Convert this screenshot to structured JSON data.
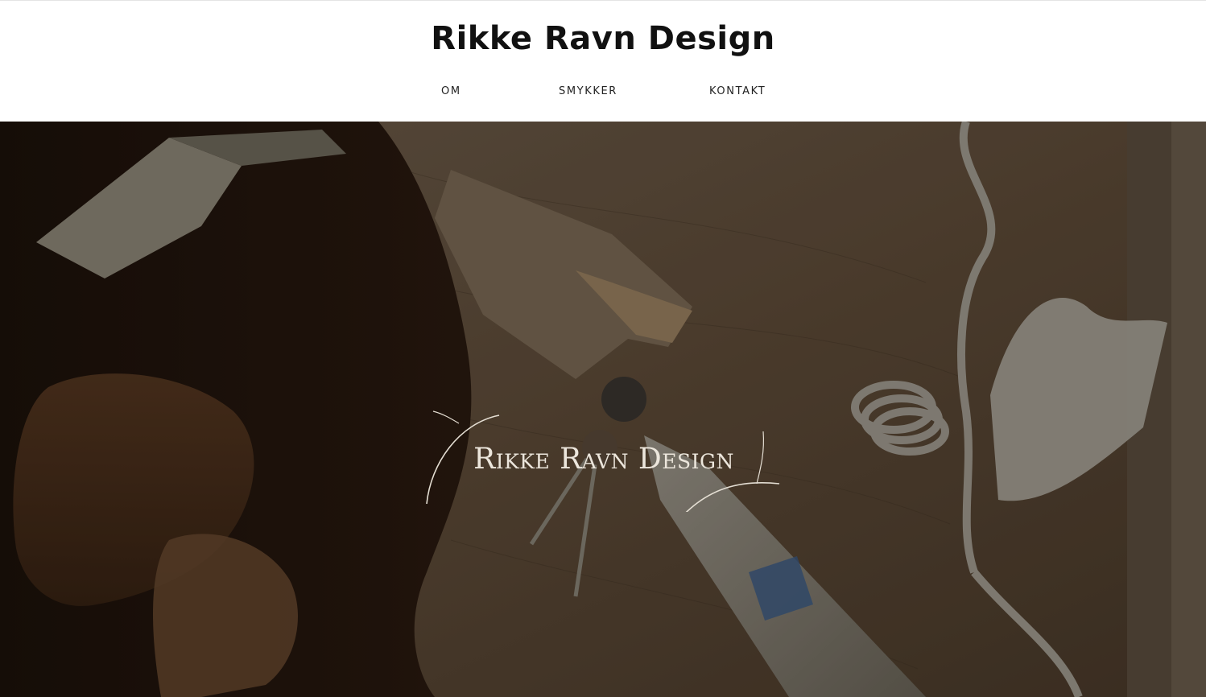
{
  "header": {
    "site_title": "Rikke Ravn Design",
    "nav": [
      {
        "label": "OM"
      },
      {
        "label": "SMYKKER"
      },
      {
        "label": "KONTAKT"
      }
    ]
  },
  "hero": {
    "logo_text": "Rikke Ravn Design",
    "image_description_icon": "workbench-photo"
  },
  "colors": {
    "header_bg": "#ffffff",
    "title_text": "#111111",
    "hero_logo_text": "#ece6dc"
  }
}
